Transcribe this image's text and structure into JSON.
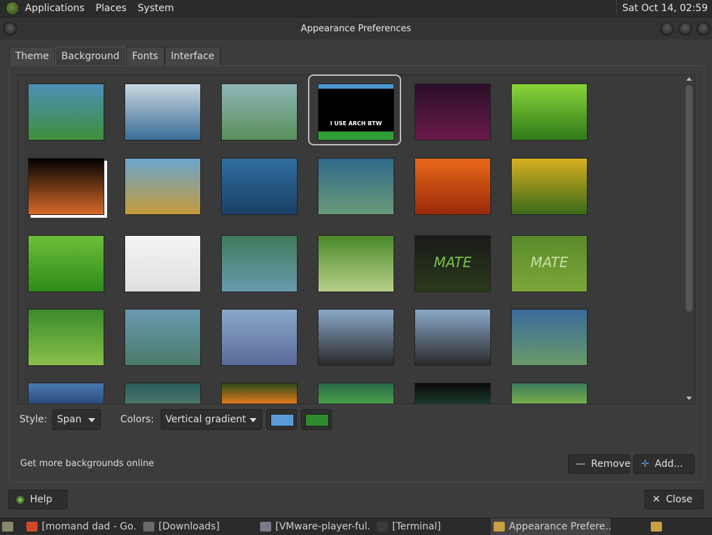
{
  "top_panel": {
    "menus": [
      "Applications",
      "Places",
      "System"
    ],
    "clock": "Sat Oct 14, 02:59"
  },
  "window": {
    "title": "Appearance Preferences"
  },
  "tabs": [
    "Theme",
    "Background",
    "Fonts",
    "Interface"
  ],
  "active_tab": "Background",
  "wallpapers": [
    [
      "#4c8fb8",
      "#3f8f3a"
    ],
    [
      "#c9d7e0",
      "#3a6d96"
    ],
    [
      "#8fb6b8",
      "#5a8f5a"
    ],
    [
      "#000000",
      "#2f9e35"
    ],
    [
      "#2a0f28",
      "#6a1a4a"
    ],
    [
      "#8ad43a",
      "#2f7a18"
    ],
    [
      "#000000",
      "#d86a2a"
    ],
    [
      "#6aa6cf",
      "#c59a3a"
    ],
    [
      "#2f6f9f",
      "#1b3f66"
    ],
    [
      "#2f6a8a",
      "#6a9a7a"
    ],
    [
      "#e8681a",
      "#9a2a0a"
    ],
    [
      "#d8b020",
      "#3a6a1a"
    ],
    [
      "#6cbf3a",
      "#2f8a1a"
    ],
    [
      "#f4f4f4",
      "#e0e0e0"
    ],
    [
      "#3f7a5a",
      "#6a9ab0"
    ],
    [
      "#4a8a2a",
      "#b8d08a"
    ],
    [
      "#1a1a1a",
      "#2a3a1a"
    ],
    [
      "#5a8a2a",
      "#7ca63a"
    ],
    [
      "#3a8a2a",
      "#8ac04a"
    ],
    [
      "#6a9ab0",
      "#4a7a6a"
    ],
    [
      "#8aa8c8",
      "#5a6a9a"
    ],
    [
      "#8aa8c8",
      "#2a2a2a"
    ],
    [
      "#8aa8c8",
      "#2a2a2a"
    ],
    [
      "#3a6a9a",
      "#6a9a6a"
    ],
    [
      "#4a7ab0",
      "#2a4a7a"
    ],
    [
      "#2a5a5a",
      "#4a7a6a"
    ],
    [
      "#2a4a1a",
      "#e87a1a"
    ],
    [
      "#2a6a4a",
      "#4aa04a"
    ],
    [
      "#0a0a0a",
      "#1a3a2a"
    ],
    [
      "#3a7a5a",
      "#7ab04a"
    ]
  ],
  "thumb_texts": [
    "I USE ARCH BTW",
    "MATE",
    "MATE"
  ],
  "selected_index": 3,
  "style": {
    "label": "Style:",
    "value": "Span"
  },
  "colors": {
    "label": "Colors:",
    "value": "Vertical gradient",
    "color1": "#5b9bd5",
    "color2": "#2e8b2e"
  },
  "get_more_link": "Get more backgrounds online",
  "buttons": {
    "remove": "Remove",
    "add": "Add...",
    "help": "Help",
    "close": "Close"
  },
  "taskbar": [
    {
      "label": "[momand dad - Go...",
      "icon": "chrome-icon",
      "color": "#d04a2a"
    },
    {
      "label": "[Downloads]",
      "icon": "folder-icon",
      "color": "#6a6a6a"
    },
    {
      "label": "[VMware-player-ful...",
      "icon": "package-icon",
      "color": "#7a7a8a"
    },
    {
      "label": "[Terminal]",
      "icon": "terminal-icon",
      "color": "#3a3a3a"
    },
    {
      "label": "Appearance Prefere...",
      "icon": "appearance-icon",
      "color": "#c8a040"
    }
  ]
}
